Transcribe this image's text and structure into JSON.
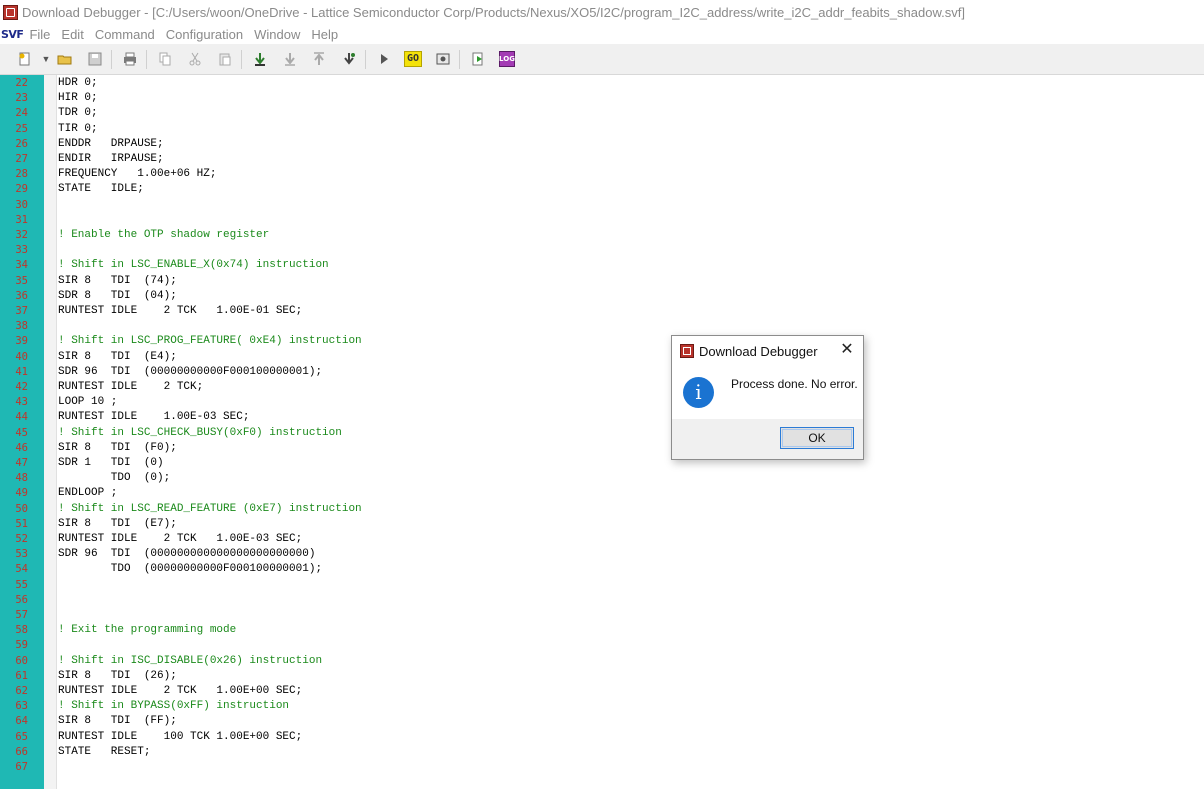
{
  "window": {
    "title": "Download Debugger - [C:/Users/woon/OneDrive - Lattice Semiconductor Corp/Products/Nexus/XO5/I2C/program_I2C_address/write_i2C_addr_feabits_shadow.svf]"
  },
  "menubar": {
    "logo": "SVF",
    "items": [
      "File",
      "Edit",
      "Command",
      "Configuration",
      "Window",
      "Help"
    ]
  },
  "toolbar": {
    "go_label": "GO",
    "log_label": "LOG"
  },
  "editor": {
    "colors": {
      "gutter": "#1fb8b4",
      "line_number": "#c0352a",
      "comment": "#1b8a1b"
    },
    "lines": [
      {
        "n": "22",
        "t": "HDR 0;",
        "c": false
      },
      {
        "n": "23",
        "t": "HIR 0;",
        "c": false
      },
      {
        "n": "24",
        "t": "TDR 0;",
        "c": false
      },
      {
        "n": "25",
        "t": "TIR 0;",
        "c": false
      },
      {
        "n": "26",
        "t": "ENDDR   DRPAUSE;",
        "c": false
      },
      {
        "n": "27",
        "t": "ENDIR   IRPAUSE;",
        "c": false
      },
      {
        "n": "28",
        "t": "FREQUENCY   1.00e+06 HZ;",
        "c": false
      },
      {
        "n": "29",
        "t": "STATE   IDLE;",
        "c": false
      },
      {
        "n": "30",
        "t": "",
        "c": false
      },
      {
        "n": "31",
        "t": "",
        "c": false
      },
      {
        "n": "32",
        "t": "! Enable the OTP shadow register",
        "c": true
      },
      {
        "n": "33",
        "t": "",
        "c": false
      },
      {
        "n": "34",
        "t": "! Shift in LSC_ENABLE_X(0x74) instruction",
        "c": true
      },
      {
        "n": "35",
        "t": "SIR 8   TDI  (74);",
        "c": false
      },
      {
        "n": "36",
        "t": "SDR 8   TDI  (04);",
        "c": false
      },
      {
        "n": "37",
        "t": "RUNTEST IDLE    2 TCK   1.00E-01 SEC;",
        "c": false
      },
      {
        "n": "38",
        "t": "",
        "c": false
      },
      {
        "n": "39",
        "t": "! Shift in LSC_PROG_FEATURE( 0xE4) instruction",
        "c": true
      },
      {
        "n": "40",
        "t": "SIR 8   TDI  (E4);",
        "c": false
      },
      {
        "n": "41",
        "t": "SDR 96  TDI  (00000000000F000100000001);",
        "c": false
      },
      {
        "n": "42",
        "t": "RUNTEST IDLE    2 TCK;",
        "c": false
      },
      {
        "n": "43",
        "t": "LOOP 10 ;",
        "c": false
      },
      {
        "n": "44",
        "t": "RUNTEST IDLE    1.00E-03 SEC;",
        "c": false
      },
      {
        "n": "45",
        "t": "! Shift in LSC_CHECK_BUSY(0xF0) instruction",
        "c": true
      },
      {
        "n": "46",
        "t": "SIR 8   TDI  (F0);",
        "c": false
      },
      {
        "n": "47",
        "t": "SDR 1   TDI  (0)",
        "c": false
      },
      {
        "n": "48",
        "t": "        TDO  (0);",
        "c": false
      },
      {
        "n": "49",
        "t": "ENDLOOP ;",
        "c": false
      },
      {
        "n": "50",
        "t": "! Shift in LSC_READ_FEATURE (0xE7) instruction",
        "c": true
      },
      {
        "n": "51",
        "t": "SIR 8   TDI  (E7);",
        "c": false
      },
      {
        "n": "52",
        "t": "RUNTEST IDLE    2 TCK   1.00E-03 SEC;",
        "c": false
      },
      {
        "n": "53",
        "t": "SDR 96  TDI  (000000000000000000000000)",
        "c": false
      },
      {
        "n": "54",
        "t": "        TDO  (00000000000F000100000001);",
        "c": false
      },
      {
        "n": "55",
        "t": "",
        "c": false
      },
      {
        "n": "56",
        "t": "",
        "c": false
      },
      {
        "n": "57",
        "t": "",
        "c": false
      },
      {
        "n": "58",
        "t": "! Exit the programming mode",
        "c": true
      },
      {
        "n": "59",
        "t": "",
        "c": false
      },
      {
        "n": "60",
        "t": "! Shift in ISC_DISABLE(0x26) instruction",
        "c": true
      },
      {
        "n": "61",
        "t": "SIR 8   TDI  (26);",
        "c": false
      },
      {
        "n": "62",
        "t": "RUNTEST IDLE    2 TCK   1.00E+00 SEC;",
        "c": false
      },
      {
        "n": "63",
        "t": "! Shift in BYPASS(0xFF) instruction",
        "c": true
      },
      {
        "n": "64",
        "t": "SIR 8   TDI  (FF);",
        "c": false
      },
      {
        "n": "65",
        "t": "RUNTEST IDLE    100 TCK 1.00E+00 SEC;",
        "c": false
      },
      {
        "n": "66",
        "t": "STATE   RESET;",
        "c": false
      },
      {
        "n": "67",
        "t": "",
        "c": false
      }
    ]
  },
  "dialog": {
    "title": "Download Debugger",
    "message": "Process done. No error.",
    "ok_label": "OK",
    "icon": "info-icon",
    "close_glyph": "✕",
    "info_glyph": "i"
  }
}
